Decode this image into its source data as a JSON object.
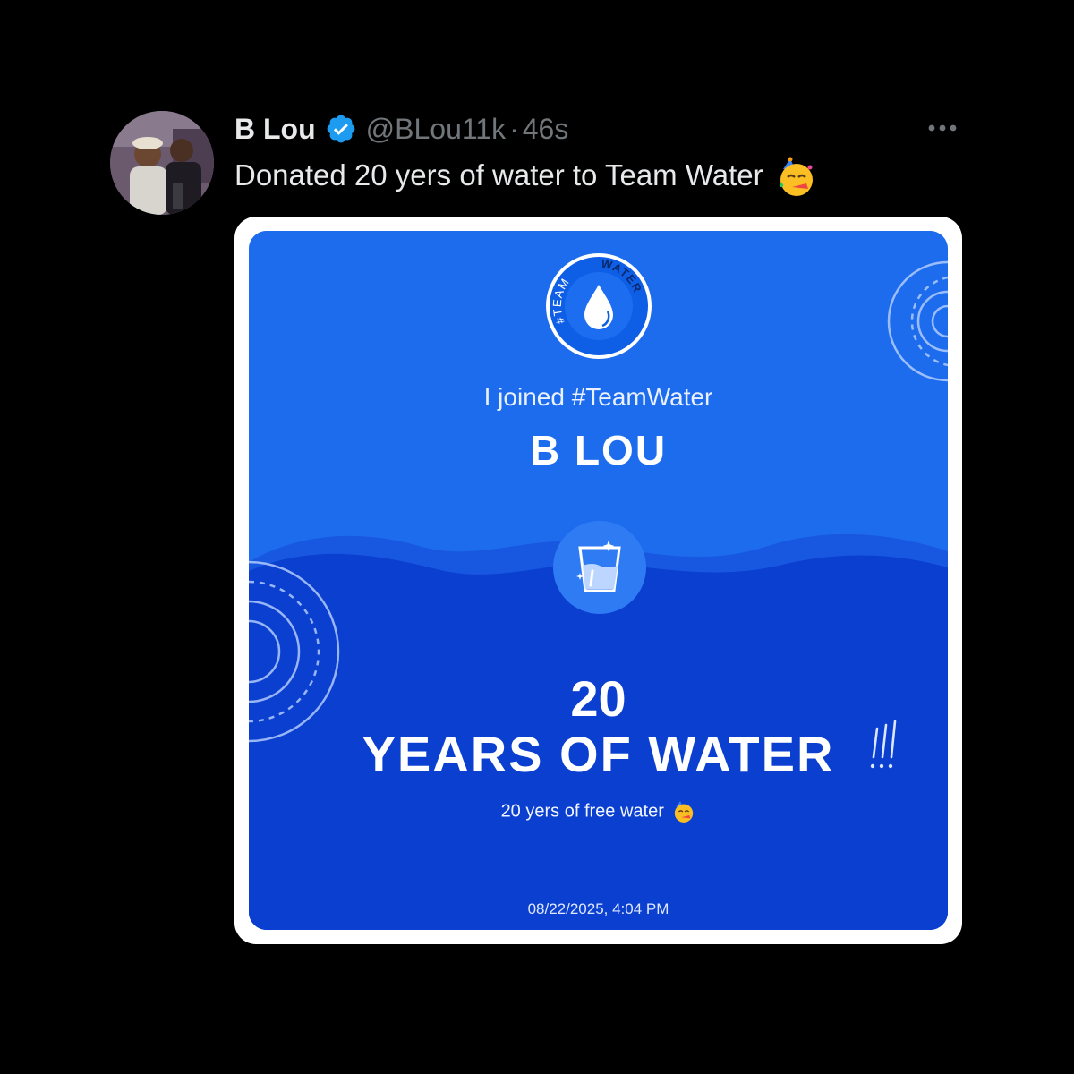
{
  "tweet": {
    "display_name": "B Lou",
    "handle": "@BLou11k",
    "separator": "·",
    "time": "46s",
    "text": "Donated 20 yers of water to Team Water"
  },
  "card": {
    "badge_words": [
      "#TEAM",
      "WATER"
    ],
    "joined_text": "I joined #TeamWater",
    "name": "B LOU",
    "years": "20",
    "title": "YEARS OF WATER",
    "subtitle": "20 yers of free water",
    "date": "08/22/2025, 4:04 PM"
  },
  "colors": {
    "background": "#000000",
    "primary_text": "#e7e9ea",
    "secondary_text": "#71767b",
    "verified": "#1d9bf0",
    "card_blue": "#1d6cee",
    "card_dark_blue": "#0a3fd0"
  },
  "icons": [
    "avatar-photo",
    "verified-badge-icon",
    "more-options-icon",
    "partying-face-emoji",
    "team-water-badge",
    "water-glass-icon",
    "exclamation-marks"
  ]
}
